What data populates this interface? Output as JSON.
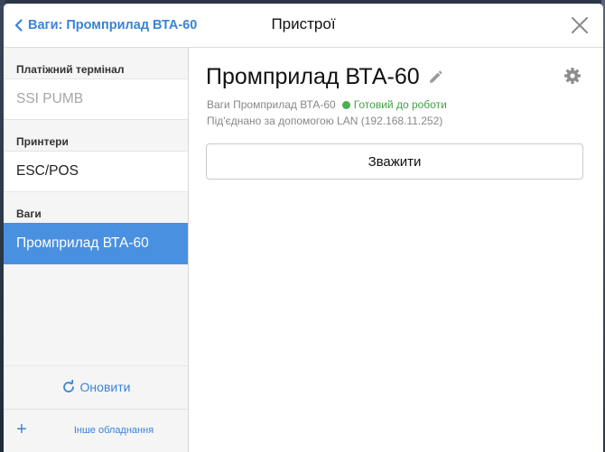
{
  "header": {
    "back_label": "Ваги: Промприлад ВТА-60",
    "title": "Пристрої"
  },
  "sidebar": {
    "sections": [
      {
        "heading": "Платіжний термінал",
        "items": [
          {
            "label": "SSI PUMB",
            "state": "disabled"
          }
        ]
      },
      {
        "heading": "Принтери",
        "items": [
          {
            "label": "ESC/POS",
            "state": "normal"
          }
        ]
      },
      {
        "heading": "Ваги",
        "items": [
          {
            "label": "Промприлад ВТА-60",
            "state": "selected"
          }
        ]
      }
    ],
    "refresh_label": "Оновити",
    "add_label": "+",
    "other_label": "Інше обладнання"
  },
  "main": {
    "device_name": "Промприлад ВТА-60",
    "device_type": "Ваги Промприлад ВТА-60",
    "status": "Готовий до роботи",
    "connection": "Під'єднано за допомогою LAN (192.168.11.252)",
    "weigh_label": "Зважити"
  },
  "colors": {
    "accent": "#3a84d8",
    "selected_bg": "#4a90e0",
    "status_ok": "#4caf50"
  },
  "icons": [
    "chevron-left-icon",
    "close-icon",
    "refresh-icon",
    "plus-icon",
    "pencil-icon",
    "gear-icon"
  ]
}
